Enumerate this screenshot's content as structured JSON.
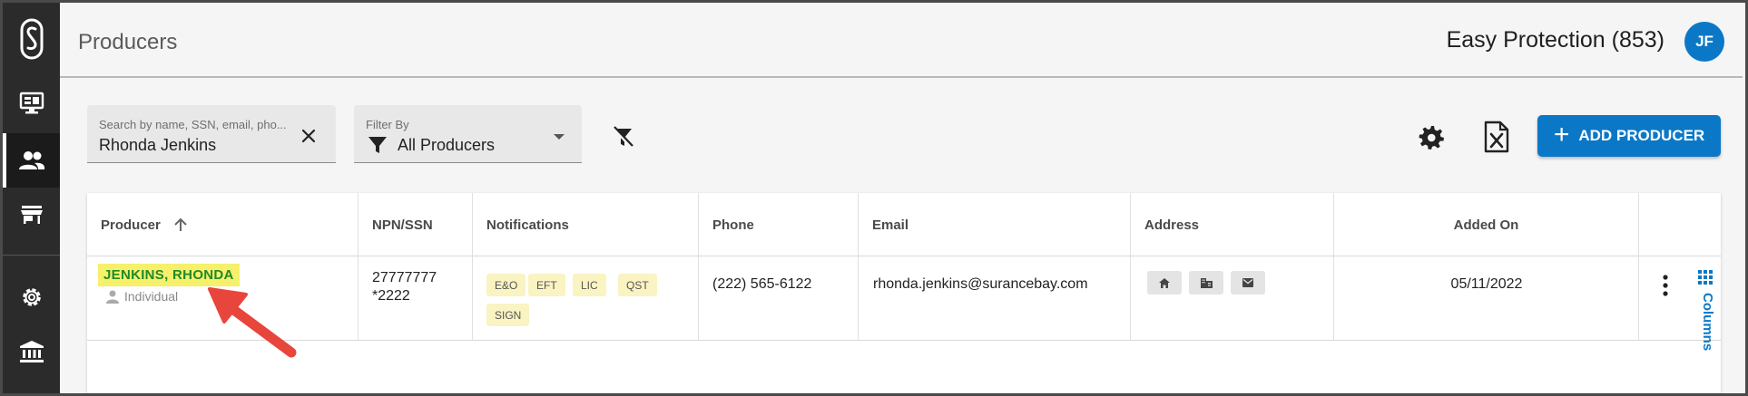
{
  "colors": {
    "sidebar_bg": "#2b2b2b",
    "accent": "#0b78c7",
    "highlight": "#f6f06a",
    "producer_text": "#1f8a2a",
    "badge_bg": "#faf3c2",
    "arrow": "#e8453c"
  },
  "sidebar": {
    "items": [
      {
        "icon": "app-logo-icon"
      },
      {
        "icon": "monitor-icon"
      },
      {
        "icon": "people-icon",
        "active": true
      },
      {
        "icon": "storefront-icon"
      },
      {
        "icon": "settings-gear-icon"
      },
      {
        "icon": "bank-icon"
      }
    ]
  },
  "header": {
    "title": "Producers",
    "company": "Easy Protection (853)",
    "avatar_initials": "JF"
  },
  "toolbar": {
    "search_placeholder": "Search by name, SSN, email, pho...",
    "search_value": "Rhonda Jenkins",
    "filter_label": "Filter By",
    "filter_value": "All Producers",
    "add_button_label": "ADD PRODUCER"
  },
  "table": {
    "columns": [
      "Producer",
      "NPN/SSN",
      "Notifications",
      "Phone",
      "Email",
      "Address",
      "Added On"
    ],
    "sort_column": "Producer",
    "rows": [
      {
        "producer": "JENKINS, RHONDA",
        "type": "Individual",
        "npn": "27777777",
        "ssn": "*2222",
        "notifications": [
          "E&O",
          "EFT",
          "LIC",
          "QST",
          "SIGN"
        ],
        "phone": "(222) 565-6122",
        "email": "rhonda.jenkins@surancebay.com",
        "address_icons": [
          "home-icon",
          "business-icon",
          "mail-icon"
        ],
        "added_on": "05/11/2022"
      }
    ],
    "columns_tab_label": "Columns"
  }
}
